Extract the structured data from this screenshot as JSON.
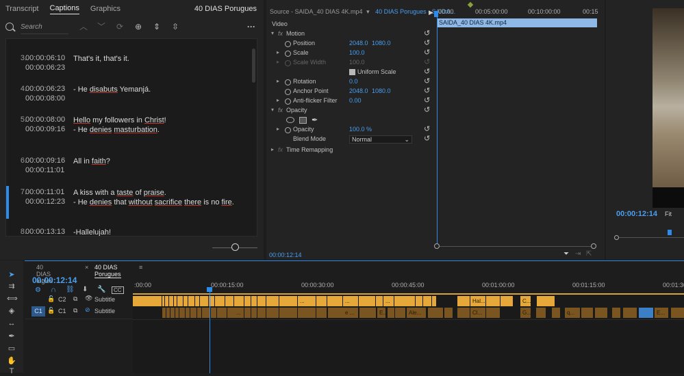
{
  "captions_panel": {
    "tabs": [
      "Transcript",
      "Captions",
      "Graphics"
    ],
    "active_tab": "Captions",
    "sequence_title": "40 DIAS Porugues",
    "search_placeholder": "Search",
    "items": [
      {
        "num": "3.",
        "in": "00:00:06:10",
        "out": "00:00:06:23",
        "lines": [
          "That's it, that's it."
        ]
      },
      {
        "num": "4.",
        "in": "00:00:06:23",
        "out": "00:00:08:00",
        "lines": [
          "- He disabuts Yemanjá."
        ]
      },
      {
        "num": "5.",
        "in": "00:00:08:00",
        "out": "00:00:09:16",
        "lines": [
          "Hello my followers in Christ!",
          "- He denies masturbation."
        ]
      },
      {
        "num": "6.",
        "in": "00:00:09:16",
        "out": "00:00:11:01",
        "lines": [
          "All in faith?"
        ]
      },
      {
        "num": "7.",
        "in": "00:00:11:01",
        "out": "00:00:12:23",
        "lines": [
          "A kiss with a taste of praise.",
          "- He denies that without sacrifice there is no fire."
        ]
      },
      {
        "num": "8.",
        "in": "00:00:13:13",
        "out": "",
        "lines": [
          "-Hallelujah!"
        ]
      }
    ]
  },
  "effects_panel": {
    "source_label": "Source - SAIDA_40 DIAS 4K.mp4",
    "sequence_label": "40 DIAS Porugues - SAIDA...",
    "section_video": "Video",
    "motion": "Motion",
    "position_label": "Position",
    "position_x": "2048.0",
    "position_y": "1080.0",
    "scale_label": "Scale",
    "scale_value": "100.0",
    "scale_width_label": "Scale Width",
    "scale_width_value": "100.0",
    "uniform_scale": "Uniform Scale",
    "rotation_label": "Rotation",
    "rotation_value": "0.0",
    "anchor_label": "Anchor Point",
    "anchor_x": "2048.0",
    "anchor_y": "1080.0",
    "flicker_label": "Anti-flicker Filter",
    "flicker_value": "0.00",
    "opacity_section": "Opacity",
    "opacity_label": "Opacity",
    "opacity_value": "100.0 %",
    "blend_label": "Blend Mode",
    "blend_value": "Normal",
    "time_remap": "Time Remapping",
    "ruler": [
      "00:00",
      "00:05:00:00",
      "00:10:00:00",
      "00:15"
    ],
    "clip_name": "SAIDA_40 DIAS 4K.mp4",
    "timecode": "00:00:12:14"
  },
  "program_monitor": {
    "timecode": "00:00:12:14",
    "fit": "Fit"
  },
  "timeline": {
    "tabs": [
      "40 DIAS Ingles",
      "40 DIAS Porugues"
    ],
    "active_tab": "40 DIAS Porugues",
    "timecode": "00:00:12:14",
    "ruler": [
      ":00:00",
      "00:00:15:00",
      "00:00:30:00",
      "00:00:45:00",
      "00:01:00:00",
      "00:01:15:00",
      "00:01:30"
    ],
    "tracks": [
      {
        "id": "C2",
        "name": "Subtitle"
      },
      {
        "id": "C1",
        "name": "Subtitle",
        "src": "C1"
      }
    ],
    "c2_labels": [
      "...",
      "...",
      "...",
      "Hal...",
      "C...",
      "G..."
    ],
    "c1_labels": [
      "...",
      "e ...",
      "E...",
      "Ale...",
      "Cl...",
      "G...",
      "q...",
      "E...",
      "E..."
    ]
  }
}
